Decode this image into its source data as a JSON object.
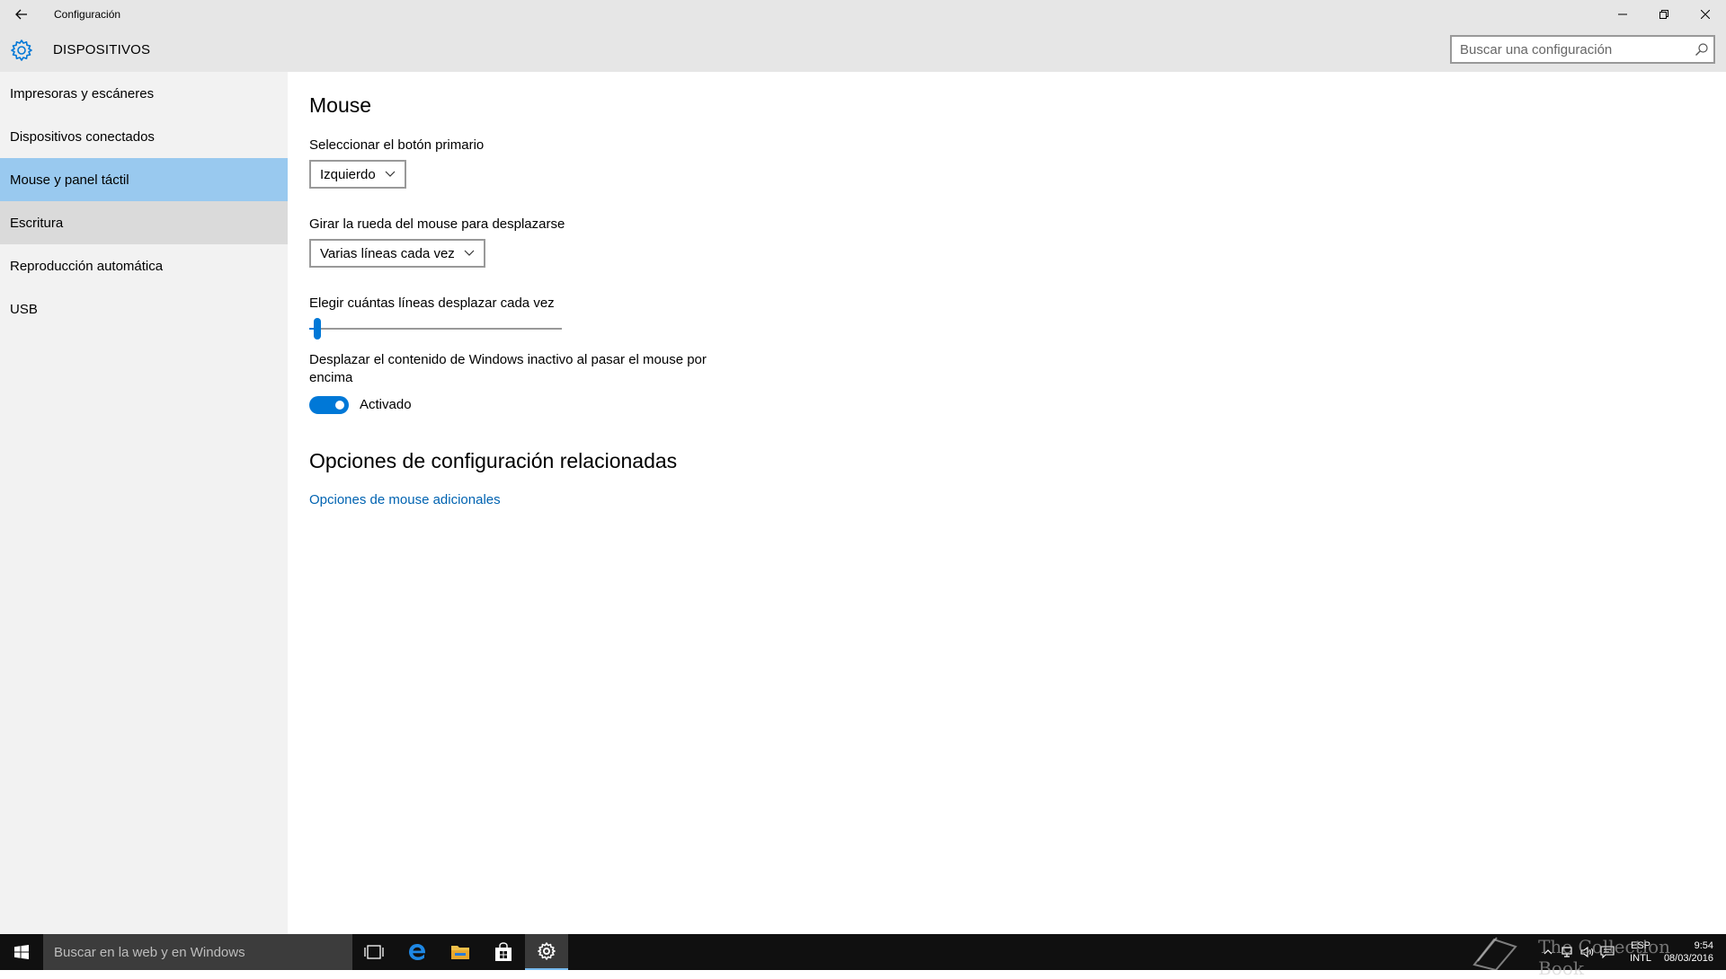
{
  "window": {
    "title": "Configuración",
    "controls": [
      "minimize-icon",
      "restore-icon",
      "close-icon"
    ]
  },
  "header": {
    "icon": "gear-icon",
    "title": "DISPOSITIVOS",
    "search_placeholder": "Buscar una configuración"
  },
  "sidebar": {
    "items": [
      {
        "label": "Impresoras y escáneres",
        "state": "normal"
      },
      {
        "label": "Dispositivos conectados",
        "state": "normal"
      },
      {
        "label": "Mouse y panel táctil",
        "state": "selected"
      },
      {
        "label": "Escritura",
        "state": "hover"
      },
      {
        "label": "Reproducción automática",
        "state": "normal"
      },
      {
        "label": "USB",
        "state": "normal"
      }
    ]
  },
  "main": {
    "section_title": "Mouse",
    "primary_button": {
      "label": "Seleccionar el botón primario",
      "value": "Izquierdo"
    },
    "wheel": {
      "label": "Girar la rueda del mouse para desplazarse",
      "value": "Varias líneas cada vez"
    },
    "lines": {
      "label": "Elegir cuántas líneas desplazar cada vez",
      "slider_fraction": 0.02
    },
    "inactive_scroll": {
      "label_line1": "Desplazar el contenido de Windows inactivo al pasar el mouse por",
      "label_line2": "encima",
      "toggle_on": true,
      "toggle_text": "Activado"
    },
    "related_title": "Opciones de configuración relacionadas",
    "related_link": "Opciones de mouse adicionales"
  },
  "taskbar": {
    "search_placeholder": "Buscar en la web y en Windows",
    "pinned_icons": [
      "task-view-icon",
      "edge-icon",
      "file-explorer-icon",
      "store-icon",
      "settings-icon"
    ],
    "active_icon": "settings-icon",
    "language": {
      "line1": "ESP",
      "line2": "INTL"
    },
    "time": "9:54",
    "date": "08/03/2016",
    "watermark": "The Collection Book"
  },
  "colors": {
    "accent": "#0078d7",
    "selected_nav": "#99c9ef",
    "link": "#0063b1"
  }
}
